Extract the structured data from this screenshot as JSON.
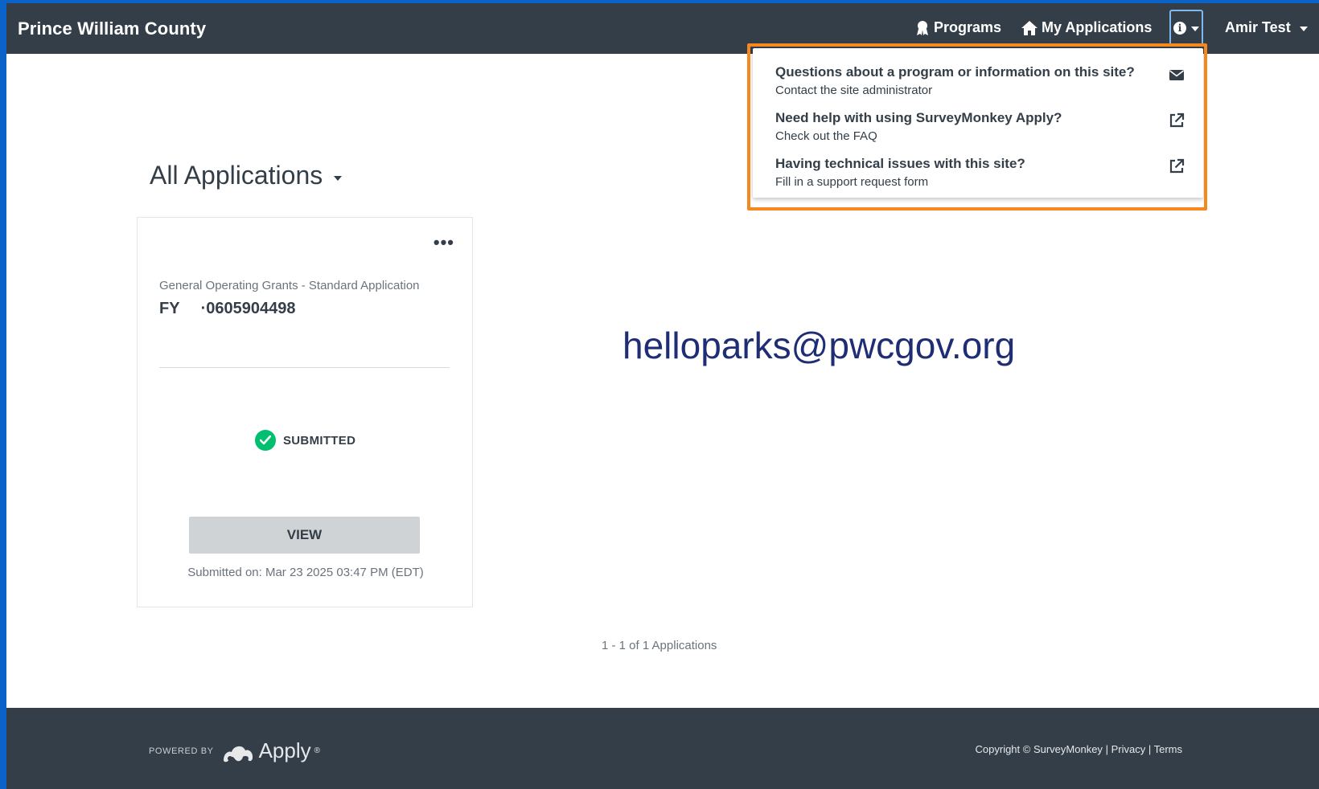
{
  "nav": {
    "brand": "Prince William County",
    "programs_label": "Programs",
    "my_applications_label": "My Applications",
    "user_label": "Amir Test",
    "info_glyph": "i"
  },
  "help_menu": {
    "items": [
      {
        "title": "Questions about a program or information on this site?",
        "subtitle": "Contact the site administrator",
        "icon": "envelope-icon"
      },
      {
        "title": "Need help with using SurveyMonkey Apply?",
        "subtitle": "Check out the FAQ",
        "icon": "external-link-icon"
      },
      {
        "title": "Having technical issues with this site?",
        "subtitle": "Fill in a support request form",
        "icon": "external-link-icon"
      }
    ]
  },
  "main": {
    "filter_title": "All Applications",
    "card": {
      "program_name": "General Operating Grants - Standard Application",
      "app_prefix": "FY",
      "app_number": "·0605904498",
      "status": "SUBMITTED",
      "view_label": "VIEW",
      "submitted_on": "Submitted on: Mar 23 2025 03:47 PM (EDT)",
      "menu_glyph": "•••"
    },
    "email_overlay": "helloparks@pwcgov.org",
    "pagination": "1 - 1 of 1 Applications"
  },
  "footer": {
    "powered_by": "POWERED BY",
    "apply_word": "Apply",
    "registered": "®",
    "copyright": "Copyright © SurveyMonkey",
    "separator": "|",
    "privacy": "Privacy",
    "terms": "Terms"
  },
  "colors": {
    "nav_bg": "#333e48",
    "accent_orange": "#f5891f",
    "status_green": "#00bf6f",
    "email_blue": "#1f2e74",
    "outer_frame_blue": "#0b63c9"
  }
}
